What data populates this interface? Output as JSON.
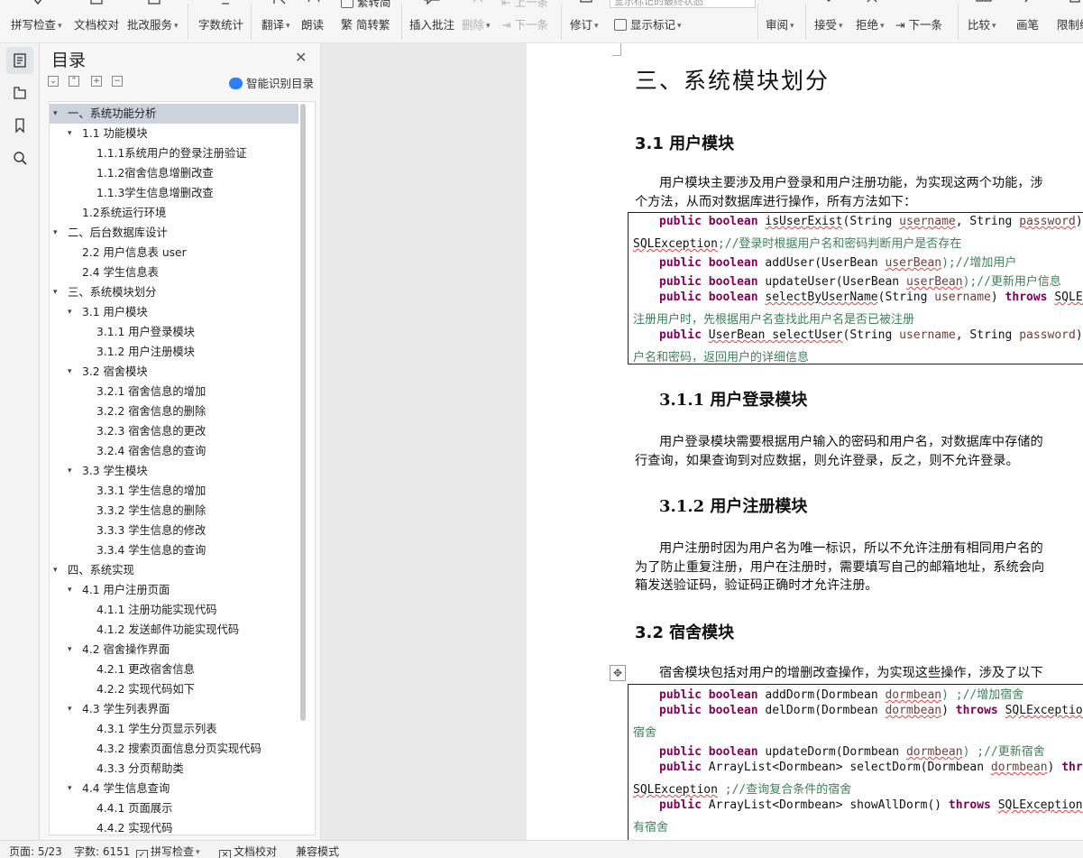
{
  "toolbar": {
    "spellcheck": "拼写检查",
    "doc_proof": "文档校对",
    "review_service": "批改服务",
    "word_count": "字数统计",
    "translate": "翻译",
    "read_aloud": "朗读",
    "trad_simp_top": "繁转简",
    "simp_trad": "简转繁",
    "insert_comment": "插入批注",
    "delete": "删除",
    "prev": "上一条",
    "next_dim": "下一条",
    "track_changes": "修订",
    "display_mode_value": "显示标记的最终状态",
    "show_markup": "显示标记",
    "review": "审阅",
    "accept": "接受",
    "reject": "拒绝",
    "next": "下一条",
    "compare": "比较",
    "ink": "画笔",
    "restrict": "限制编"
  },
  "toc": {
    "title": "目录",
    "smart_toc": "智能识别目录",
    "items": [
      {
        "text": "一、系统功能分析",
        "level": 0,
        "expanded": true,
        "selected": true
      },
      {
        "text": "1.1  功能模块",
        "level": 1,
        "expanded": true
      },
      {
        "text": "1.1.1系统用户的登录注册验证",
        "level": 2
      },
      {
        "text": "1.1.2宿舍信息增删改查",
        "level": 2
      },
      {
        "text": "1.1.3学生信息增删改查",
        "level": 2
      },
      {
        "text": "1.2系统运行环境",
        "level": 1
      },
      {
        "text": "二、后台数据库设计",
        "level": 0,
        "expanded": true
      },
      {
        "text": "2.2  用户信息表 user",
        "level": 1
      },
      {
        "text": "2.4 学生信息表",
        "level": 1
      },
      {
        "text": "三、系统模块划分",
        "level": 0,
        "expanded": true
      },
      {
        "text": "3.1  用户模块",
        "level": 1,
        "expanded": true
      },
      {
        "text": "3.1.1  用户登录模块",
        "level": 2
      },
      {
        "text": "3.1.2 用户注册模块",
        "level": 2
      },
      {
        "text": "3.2  宿舍模块",
        "level": 1,
        "expanded": true
      },
      {
        "text": "3.2.1  宿舍信息的增加",
        "level": 2
      },
      {
        "text": "3.2.2  宿舍信息的删除",
        "level": 2
      },
      {
        "text": "3.2.3  宿舍信息的更改",
        "level": 2
      },
      {
        "text": "3.2.4  宿舍信息的查询",
        "level": 2
      },
      {
        "text": "3.3 学生模块",
        "level": 1,
        "expanded": true
      },
      {
        "text": "3.3.1 学生信息的增加",
        "level": 2
      },
      {
        "text": "3.3.2 学生信息的删除",
        "level": 2
      },
      {
        "text": "3.3.3 学生信息的修改",
        "level": 2
      },
      {
        "text": "3.3.4 学生信息的查询",
        "level": 2
      },
      {
        "text": "四、系统实现",
        "level": 0,
        "expanded": true
      },
      {
        "text": "4.1 用户注册页面",
        "level": 1,
        "expanded": true
      },
      {
        "text": "4.1.1 注册功能实现代码",
        "level": 2
      },
      {
        "text": "4.1.2 发送邮件功能实现代码",
        "level": 2
      },
      {
        "text": "4.2 宿舍操作界面",
        "level": 1,
        "expanded": true
      },
      {
        "text": "4.2.1 更改宿舍信息",
        "level": 2
      },
      {
        "text": "4.2.2 实现代码如下",
        "level": 2
      },
      {
        "text": "4.3 学生列表界面",
        "level": 1,
        "expanded": true
      },
      {
        "text": "4.3.1  学生分页显示列表",
        "level": 2
      },
      {
        "text": "4.3.2 搜索页面信息分页实现代码",
        "level": 2
      },
      {
        "text": "4.3.3 分页帮助类",
        "level": 2
      },
      {
        "text": "4.4 学生信息查询",
        "level": 1,
        "expanded": true
      },
      {
        "text": "4.4.1 页面展示",
        "level": 2
      },
      {
        "text": "4.4.2 实现代码",
        "level": 2
      }
    ]
  },
  "doc": {
    "h_sec3": "三、系统模块划分",
    "h_31": "3.1  用户模块",
    "p_31_l1": "用户模块主要涉及用户登录和用户注册功能，为实现这两个功能，涉",
    "p_31_l2": "个方法，从而对数据库进行操作，所有方法如下：",
    "code1": {
      "l1_kw": "public boolean ",
      "l1_fn": "isUserExist",
      "l1_a": "(String ",
      "l1_v1": "username",
      "l1_b": ", String ",
      "l1_v2": "password",
      "l1_c": ") ",
      "l2_ex": "SQLException",
      "l2_cm": ";//登录时根据用户名和密码判断用户是否存在",
      "l3_kw": "public boolean ",
      "l3_fn": "addUser",
      "l3_a": "(UserBean ",
      "l3_v": "userBean",
      "l3_cm": ");//增加用户",
      "l4_kw": "public boolean ",
      "l4_fn": "updateUser",
      "l4_a": "(UserBean ",
      "l4_v": "userBean",
      "l4_cm": ");//更新用户信息",
      "l5_kw": "public boolean ",
      "l5_fn": "selectByUserName",
      "l5_a": "(String ",
      "l5_v": "username",
      "l5_b": ") ",
      "l5_kw2": "throws ",
      "l5_ex": "SQLExcep",
      "l6_cm": "注册用户时，先根据用户名查找此用户名是否已被注册",
      "l7_kw": "public ",
      "l7_t": "UserBean",
      "l7_fn": " selectUser",
      "l7_a": "(String ",
      "l7_v1": "username",
      "l7_b": ", String ",
      "l7_v2": "password",
      "l7_c": ");",
      "l8_cm": "户名和密码，返回用户的详细信息"
    },
    "h_311": "3.1.1  用户登录模块",
    "p_311_l1": "用户登录模块需要根据用户输入的密码和用户名，对数据库中存储的",
    "p_311_l2": "行查询，如果查询到对应数据，则允许登录，反之，则不允许登录。",
    "h_312": "3.1.2 用户注册模块",
    "p_312_l1": "用户注册时因为用户名为唯一标识，所以不允许注册有相同用户名的",
    "p_312_l2": "为了防止重复注册，用户在注册时，需要填写自己的邮箱地址，系统会向",
    "p_312_l3": "箱发送验证码，验证码正确时才允许注册。",
    "h_32": "3.2  宿舍模块",
    "p_32_l1": "宿舍模块包括对用户的增删改查操作，为实现这些操作，涉及了以下",
    "code2": {
      "l1_kw": "public boolean ",
      "l1_fn": "addDorm",
      "l1_a": "(Dormbean ",
      "l1_v": "dormbean",
      "l1_cm": ") ;//增加宿舍",
      "l2_kw": "public boolean ",
      "l2_fn": "delDorm",
      "l2_a": "(Dormbean ",
      "l2_v": "dormbean",
      "l2_b": ")  ",
      "l2_kw2": "throws ",
      "l2_ex": "SQLException",
      "l3_cm": "宿舍",
      "l4_kw": "public boolean ",
      "l4_fn": "updateDorm",
      "l4_a": "(Dormbean ",
      "l4_v": "dormbean",
      "l4_cm": ") ;//更新宿舍",
      "l5_kw": "public ",
      "l5_t": "ArrayList",
      "l5_g": "<Dormbean> ",
      "l5_fn": "selectDorm",
      "l5_a": "(Dormbean ",
      "l5_v": "dormbean",
      "l5_b": ") ",
      "l5_kw2": "thro",
      "l6_ex": "SQLException",
      "l6_cm": " ;//查询复合条件的宿舍",
      "l7_kw": "public ",
      "l7_t": "ArrayList",
      "l7_g": "<Dormbean> ",
      "l7_fn": "showAllDorm",
      "l7_a": "() ",
      "l7_kw2": "throws ",
      "l7_ex": "SQLException",
      "l7_c": ";",
      "l8_cm": "有宿舍"
    }
  },
  "status": {
    "page": "页面: 5/23",
    "words": "字数: 6151",
    "spellcheck": "拼写检查",
    "doc_proof": "文档校对",
    "compat": "兼容模式"
  },
  "colors": {
    "keyword": "#7f0055",
    "comment": "#3f7f5f",
    "variable": "#6a3e3e",
    "toc_selected": "#cdd3dc",
    "accent": "#2d7ff9"
  }
}
